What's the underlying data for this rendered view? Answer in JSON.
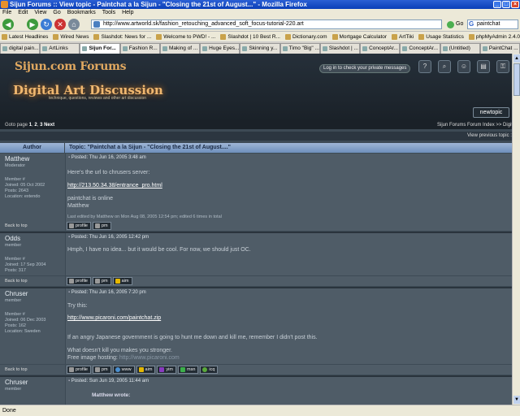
{
  "window": {
    "title": "Sijun Forums :: View topic - Paintchat a la Sijun - \"Closing the 21st of August...\" - Mozilla Firefox",
    "minimize": "_",
    "maximize": "□",
    "close": "×"
  },
  "menu": [
    "File",
    "Edit",
    "View",
    "Go",
    "Bookmarks",
    "Tools",
    "Help"
  ],
  "nav": {
    "url": "http://www.artworld.sk/fashion_retouching_advanced_soft_focus-tutorial-220.art",
    "go_label": "Go",
    "search_value": "paintchat",
    "search_engine": "G"
  },
  "bookmarks": [
    "Latest Headlines",
    "Wired News",
    "Slashdot: News for ...",
    "Welcome to PWD! - ...",
    "Slashdot | 10 Best R...",
    "Dictionary.com",
    "Mortgage Calculator",
    "ArtTiki",
    "Usage Statistics",
    "phpMyAdmin 2.4.0"
  ],
  "tabs": [
    {
      "label": "digital pain..."
    },
    {
      "label": "ArtLinks"
    },
    {
      "label": "Sijun For...",
      "active": true
    },
    {
      "label": "Fashion R..."
    },
    {
      "label": "Making of ..."
    },
    {
      "label": "Huge Eyes..."
    },
    {
      "label": "Skinning y..."
    },
    {
      "label": "Timo \"Big\" ..."
    },
    {
      "label": "Slashdot | ..."
    },
    {
      "label": "ConceptAr..."
    },
    {
      "label": "ConceptAr..."
    },
    {
      "label": "(Untitled)"
    },
    {
      "label": "PaintChat ..."
    }
  ],
  "forum": {
    "logo_top": "Sijun.com Forums",
    "logo_main": "Digital Art Discussion",
    "logo_tag": "technique, questions, reviews and other art discussion",
    "pm_link": "Log in to check your private messages",
    "new_topic": "newtopic",
    "goto": {
      "label": "Goto page",
      "current": "1",
      "sep1": ",",
      "p2": "2",
      "sep2": ",",
      "p3": "3",
      "next": "Next"
    },
    "index_link": "Sijun Forums Forum Index >> Digital Art",
    "prev_topic": "View previous topic :: View next topic",
    "col_author": "Author",
    "topic_prefix": "Topic:",
    "topic_title": "\"Paintchat a la Sijun - \"Closing the 21st of August....\""
  },
  "posts": [
    {
      "author": "Matthew",
      "rank": "Moderator",
      "member_no": "Member #",
      "joined": "Joined: 05 Oct 2002",
      "posts": "Posts: 2643",
      "location": "Location: extendo",
      "date": "Posted: Thu Jun 16, 2005 3:48 am",
      "l1": "Here's the url to chrusers server:",
      "l2": "http://213.50.34.38/entrance_pro.html",
      "l3": "paintchat is online",
      "l4": "Matthew",
      "edited": "Last edited by Matthew on Mon Aug 08, 2005 12:54 pm; edited 6 times in total",
      "back": "Back to top",
      "btn_profile": "profile",
      "btn_pm": "pm"
    },
    {
      "author": "Odds",
      "rank": "member",
      "member_no": "Member #",
      "joined": "Joined: 17 Sep 2004",
      "posts": "Posts: 317",
      "date": "Posted: Thu Jun 16, 2005 12:42 pm",
      "l1": "Hmph, I have no idea... but it would be cool. For now, we should just OC.",
      "back": "Back to top",
      "btn_profile": "profile",
      "btn_pm": "pm",
      "btn_aim": "aim"
    },
    {
      "author": "Chruser",
      "rank": "member",
      "member_no": "Member #",
      "joined": "Joined: 06 Dec 2003",
      "posts": "Posts: 162",
      "location": "Location: Sweden",
      "date": "Posted: Thu Jun 16, 2005 7:20 pm",
      "l1": "Try this:",
      "l2": "http://www.picaroni.com/paintchat.zip",
      "l3": "If an angry Japanese government is going to hunt me down and kill me, remember I didn't post this.",
      "l4": "What doesn't kill you makes you stronger.",
      "l5a": "Free image hosting: ",
      "l5b": "http://www.picaroni.com",
      "back": "Back to top",
      "btn_profile": "profile",
      "btn_pm": "pm",
      "btn_www": "www",
      "btn_aim": "aim",
      "btn_yim": "yim",
      "btn_msn": "msn",
      "btn_icq": "icq"
    },
    {
      "author": "Chruser",
      "rank": "member",
      "date": "Posted: Sun Jun 19, 2005 11:44 am",
      "quote": "Matthew wrote:"
    }
  ],
  "status": "Done"
}
